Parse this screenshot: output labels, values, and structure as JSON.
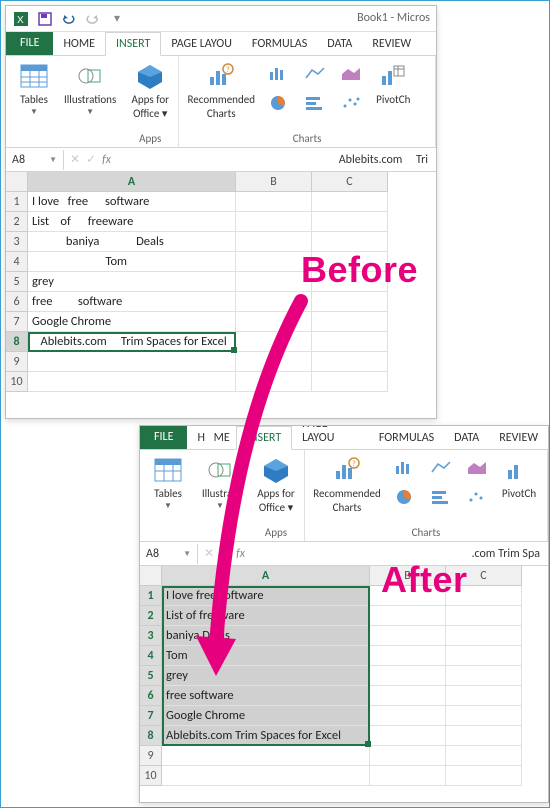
{
  "title": "Book1 - Micros",
  "tabs": {
    "file": "FILE",
    "home": "HOME",
    "insert": "INSERT",
    "pagelayout": "PAGE LAYOU",
    "formulas": "FORMULAS",
    "data": "DATA",
    "review": "REVIEW"
  },
  "ribbon": {
    "tables": "Tables",
    "illustrations": "Illustrations",
    "illustrations_short": "Illustrati",
    "apps_line1": "Apps for",
    "apps_line2": "Office ▾",
    "apps_group": "Apps",
    "rec_line1": "Recommended",
    "rec_line2": "Charts",
    "charts_group": "Charts",
    "pivot": "PivotCh"
  },
  "before": {
    "namebox": "A8",
    "formula_value": "   Ablebits.com     Tri",
    "cols": [
      "A",
      "B",
      "C"
    ],
    "rows": [
      "I love   free      software",
      "List    of      freeware",
      "            baniya             Deals",
      "                          Tom",
      "grey",
      "free         software",
      "Google Chrome",
      "   Ablebits.com     Trim Spaces for Excel"
    ],
    "extra_rows": [
      "9",
      "10"
    ]
  },
  "after": {
    "namebox": "A8",
    "formula_value": ".com Trim Spa",
    "cols": [
      "A",
      "B",
      "C"
    ],
    "rows": [
      "I love free software",
      "List of freeware",
      "baniya Deals",
      "Tom",
      "grey",
      "free software",
      "Google Chrome",
      "Ablebits.com Trim Spaces for Excel"
    ],
    "extra_rows": [
      "9",
      "10"
    ]
  },
  "annot": {
    "before": "Before",
    "after": "After"
  }
}
